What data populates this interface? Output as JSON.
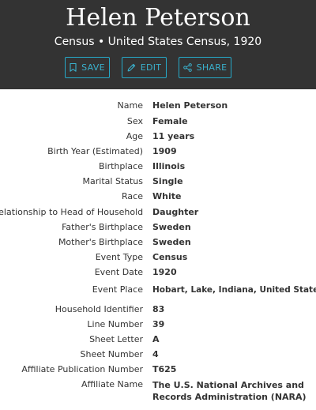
{
  "record": {
    "name": "Helen Peterson",
    "subtitle": "Census • United States Census, 1920"
  },
  "actions": {
    "save": "SAVE",
    "edit": "EDIT",
    "share": "SHARE"
  },
  "fields": [
    {
      "label": "Name",
      "value": "Helen Peterson"
    },
    {
      "label": "Sex",
      "value": "Female"
    },
    {
      "label": "Age",
      "value": "11 years"
    },
    {
      "label": "Birth Year (Estimated)",
      "value": "1909"
    },
    {
      "label": "Birthplace",
      "value": "Illinois"
    },
    {
      "label": "Marital Status",
      "value": "Single"
    },
    {
      "label": "Race",
      "value": "White"
    },
    {
      "label": "Relationship to Head of Household",
      "value": "Daughter"
    },
    {
      "label": "Father's Birthplace",
      "value": "Sweden"
    },
    {
      "label": "Mother's Birthplace",
      "value": "Sweden"
    },
    {
      "label": "Event Type",
      "value": "Census"
    },
    {
      "label": "Event Date",
      "value": "1920"
    },
    {
      "label": "Event Place",
      "value": "Hobart, Lake, Indiana, United States"
    },
    {
      "label": "Household Identifier",
      "value": "83"
    },
    {
      "label": "Line Number",
      "value": "39"
    },
    {
      "label": "Sheet Letter",
      "value": "A"
    },
    {
      "label": "Sheet Number",
      "value": "4"
    },
    {
      "label": "Affiliate Publication Number",
      "value": "T625"
    },
    {
      "label": "Affiliate Name",
      "value": "The U.S. National Archives and Records Administration (NARA)"
    }
  ],
  "colors": {
    "header_bg": "#333333",
    "accent": "#26a9c8"
  }
}
